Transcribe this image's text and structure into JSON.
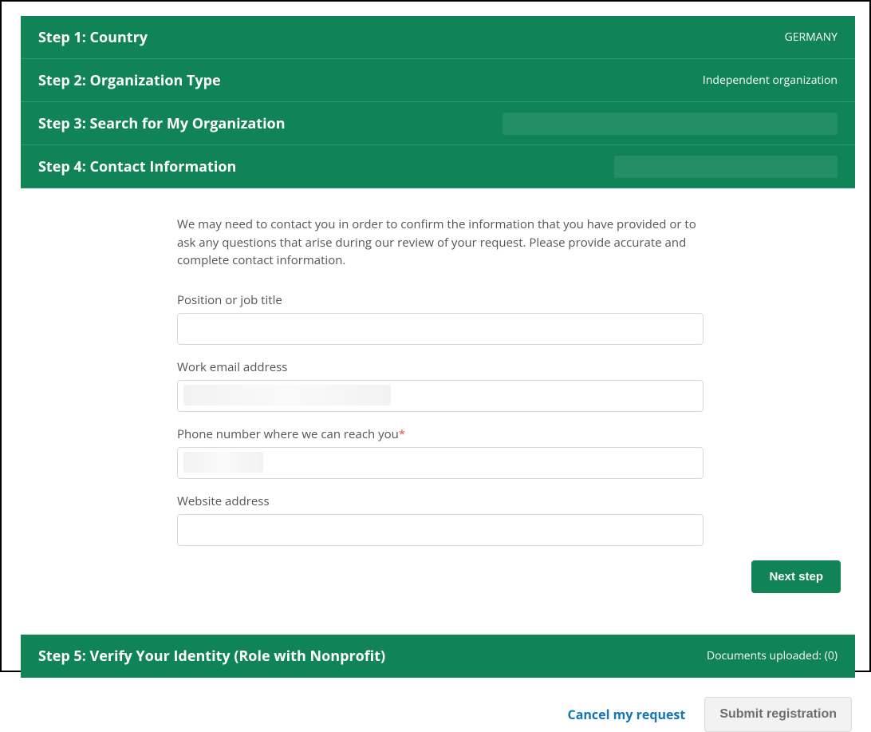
{
  "steps": {
    "s1": {
      "title": "Step 1: Country",
      "value": "GERMANY"
    },
    "s2": {
      "title": "Step 2: Organization Type",
      "value": "Independent organization"
    },
    "s3": {
      "title": "Step 3: Search for My Organization"
    },
    "s4": {
      "title": "Step 4: Contact Information"
    },
    "s5": {
      "title": "Step 5: Verify Your Identity (Role with Nonprofit)",
      "value": "Documents uploaded: (0)"
    }
  },
  "panel": {
    "instructions": "We may need to contact you in order to confirm the information that you have provided or to ask any questions that arise during our review of your request. Please provide accurate and complete contact information.",
    "fields": {
      "position": {
        "label": "Position or job title",
        "value": ""
      },
      "email": {
        "label": "Work email address",
        "value": ""
      },
      "phone": {
        "label": "Phone number where we can reach you",
        "required_mark": "*",
        "value": ""
      },
      "website": {
        "label": "Website address",
        "value": ""
      }
    },
    "next_button": "Next step"
  },
  "footer": {
    "cancel": "Cancel my request",
    "submit": "Submit registration"
  }
}
